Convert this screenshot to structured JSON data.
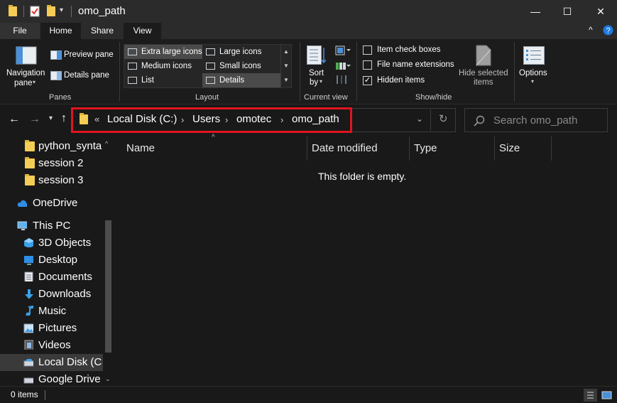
{
  "window": {
    "title": "omo_path",
    "minimize": "—",
    "maximize": "☐",
    "close": "✕"
  },
  "tabs": {
    "file": "File",
    "home": "Home",
    "share": "Share",
    "view": "View"
  },
  "ribbon": {
    "panes": {
      "navigation_pane_line1": "Navigation",
      "navigation_pane_line2": "pane",
      "preview_pane": "Preview pane",
      "details_pane": "Details pane",
      "title": "Panes"
    },
    "layout": {
      "extra_large_icons": "Extra large icons",
      "large_icons": "Large icons",
      "medium_icons": "Medium icons",
      "small_icons": "Small icons",
      "list": "List",
      "details": "Details",
      "title": "Layout"
    },
    "current_view": {
      "sort_by_line1": "Sort",
      "sort_by_line2": "by",
      "title": "Current view"
    },
    "show_hide": {
      "item_check_boxes": "Item check boxes",
      "file_name_extensions": "File name extensions",
      "hidden_items": "Hidden items",
      "hide_selected_line1": "Hide selected",
      "hide_selected_line2": "items",
      "title": "Show/hide"
    },
    "options": "Options"
  },
  "address": {
    "prefix": "«",
    "crumbs": [
      "Local Disk (C:)",
      "Users",
      "omotec",
      "omo_path"
    ],
    "separator": "›"
  },
  "search": {
    "placeholder": "Search omo_path"
  },
  "sidebar": {
    "items": [
      {
        "label": "python_synta"
      },
      {
        "label": "session 2"
      },
      {
        "label": "session 3"
      },
      {
        "label": "OneDrive"
      },
      {
        "label": "This PC"
      },
      {
        "label": "3D Objects"
      },
      {
        "label": "Desktop"
      },
      {
        "label": "Documents"
      },
      {
        "label": "Downloads"
      },
      {
        "label": "Music"
      },
      {
        "label": "Pictures"
      },
      {
        "label": "Videos"
      },
      {
        "label": "Local Disk (C"
      },
      {
        "label": "Google Drive"
      }
    ]
  },
  "columns": {
    "name": "Name",
    "date_modified": "Date modified",
    "type": "Type",
    "size": "Size"
  },
  "content": {
    "empty_message": "This folder is empty."
  },
  "status": {
    "item_count": "0 items"
  },
  "colors": {
    "highlight": "#e0141e",
    "folder": "#f4cd56",
    "onedrive": "#2d8ee6"
  }
}
